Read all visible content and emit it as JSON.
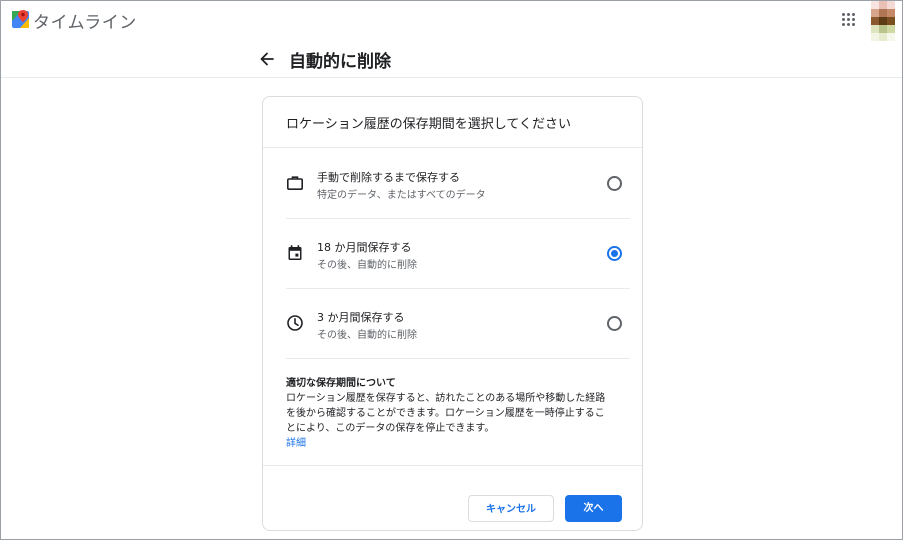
{
  "app": {
    "title": "タイムライン"
  },
  "header": {
    "title": "自動的に削除"
  },
  "card": {
    "heading": "ロケーション履歴の保存期間を選択してください",
    "options": [
      {
        "icon": "briefcase-icon",
        "title": "手動で削除するまで保存する",
        "subtitle": "特定のデータ、またはすべてのデータ",
        "selected": false
      },
      {
        "icon": "calendar-icon",
        "title": "18 か月間保存する",
        "subtitle": "その後、自動的に削除",
        "selected": true
      },
      {
        "icon": "clock-icon",
        "title": "3 か月間保存する",
        "subtitle": "その後、自動的に削除",
        "selected": false
      }
    ],
    "info": {
      "title": "適切な保存期間について",
      "lines": [
        "ロケーション履歴を保存すると、訪れたことのある場所や移動した経路",
        "を後から確認することができます。ロケーション履歴を一時停止するこ",
        "とにより、このデータの保存を停止できます。"
      ],
      "link": "詳細"
    },
    "buttons": {
      "cancel": "キャンセル",
      "next": "次へ"
    }
  },
  "colors": {
    "accent": "#1a73e8",
    "text": "#202124",
    "secondary_text": "#5f6368",
    "divider": "#e8eaed"
  }
}
